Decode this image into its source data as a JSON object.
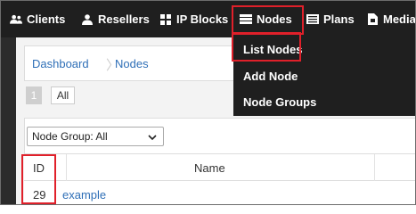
{
  "nav": {
    "items": [
      {
        "label": "Clients",
        "icon": "users-icon"
      },
      {
        "label": "Resellers",
        "icon": "user-icon"
      },
      {
        "label": "IP Blocks",
        "icon": "grid-icon"
      },
      {
        "label": "Nodes",
        "icon": "server-icon"
      },
      {
        "label": "Plans",
        "icon": "list-icon"
      },
      {
        "label": "Media",
        "icon": "media-icon"
      }
    ],
    "active": "Nodes"
  },
  "dropdown": {
    "items": [
      "List Nodes",
      "Add Node",
      "Node Groups"
    ]
  },
  "breadcrumb": [
    "Dashboard",
    "Nodes"
  ],
  "pager": {
    "current": "1",
    "all_label": "All"
  },
  "filter": {
    "node_group_label": "Node Group: All"
  },
  "table": {
    "columns": [
      "ID",
      "Name"
    ],
    "rows": [
      {
        "id": "29",
        "name": "example"
      }
    ]
  },
  "colors": {
    "highlight": "#e0202a",
    "nav_bg": "#1f1f1f",
    "link": "#2f6fb7"
  }
}
